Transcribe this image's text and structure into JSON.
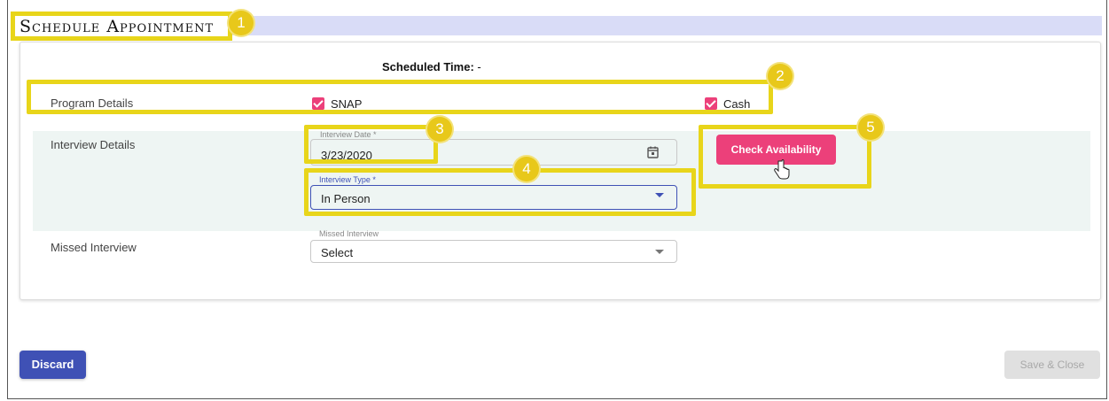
{
  "header": {
    "title": "Schedule Appointment"
  },
  "schedule": {
    "label": "Scheduled Time:",
    "value": " -"
  },
  "program": {
    "label": "Program Details",
    "options": [
      {
        "label": "SNAP",
        "checked": true
      },
      {
        "label": "Cash",
        "checked": true
      }
    ]
  },
  "interview": {
    "label": "Interview Details",
    "date": {
      "label": "Interview Date *",
      "value": "3/23/2020",
      "icon": "calendar-icon"
    },
    "type": {
      "label": "Interview Type *",
      "value": "In Person"
    },
    "check_button": "Check Availability"
  },
  "missed": {
    "label": "Missed Interview",
    "field_label": "Missed Interview",
    "value": "Select"
  },
  "footer": {
    "discard": "Discard",
    "save": "Save & Close"
  },
  "badges": [
    "1",
    "2",
    "3",
    "4",
    "5"
  ],
  "colors": {
    "accent_pink": "#ec407a",
    "primary": "#3f51b5",
    "highlight": "#e8d51a"
  }
}
